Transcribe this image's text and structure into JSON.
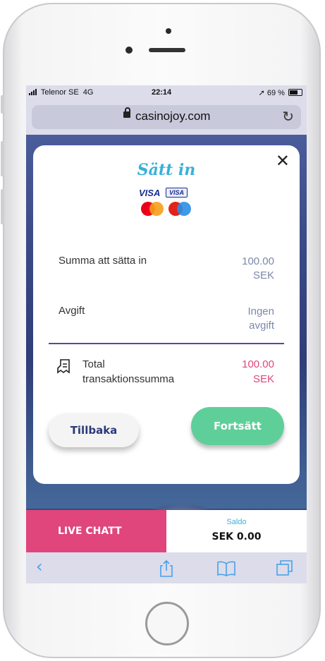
{
  "status": {
    "carrier": "Telenor SE",
    "network": "4G",
    "time": "22:14",
    "battery": "69 %"
  },
  "browser": {
    "url": "casinojoy.com",
    "reload_icon": "reload-icon",
    "toolbar_icons": [
      "back-icon",
      "share-icon",
      "bookmarks-icon",
      "tabs-icon"
    ]
  },
  "modal": {
    "title": "Sätt in",
    "close_label": "✕",
    "payment_logos": [
      "VISA",
      "VISA"
    ],
    "rows": [
      {
        "label": "Summa att sätta in",
        "value_line1": "100.00",
        "value_line2": "SEK"
      },
      {
        "label": "Avgift",
        "value_line1": "Ingen",
        "value_line2": "avgift"
      }
    ],
    "total": {
      "label_line1": "Total",
      "label_line2": "transaktionssumma",
      "value_line1": "100.00",
      "value_line2": "SEK"
    },
    "back_button": "Tillbaka",
    "continue_button": "Fortsätt"
  },
  "bottom": {
    "live_chat": "LIVE CHATT",
    "saldo_label": "Saldo",
    "saldo_amount": "SEK 0.00"
  },
  "colors": {
    "accent_pink": "#e0457b",
    "accent_green": "#5fcf9a",
    "accent_blue": "#3ab0d8",
    "divider": "#4e4aa0"
  }
}
